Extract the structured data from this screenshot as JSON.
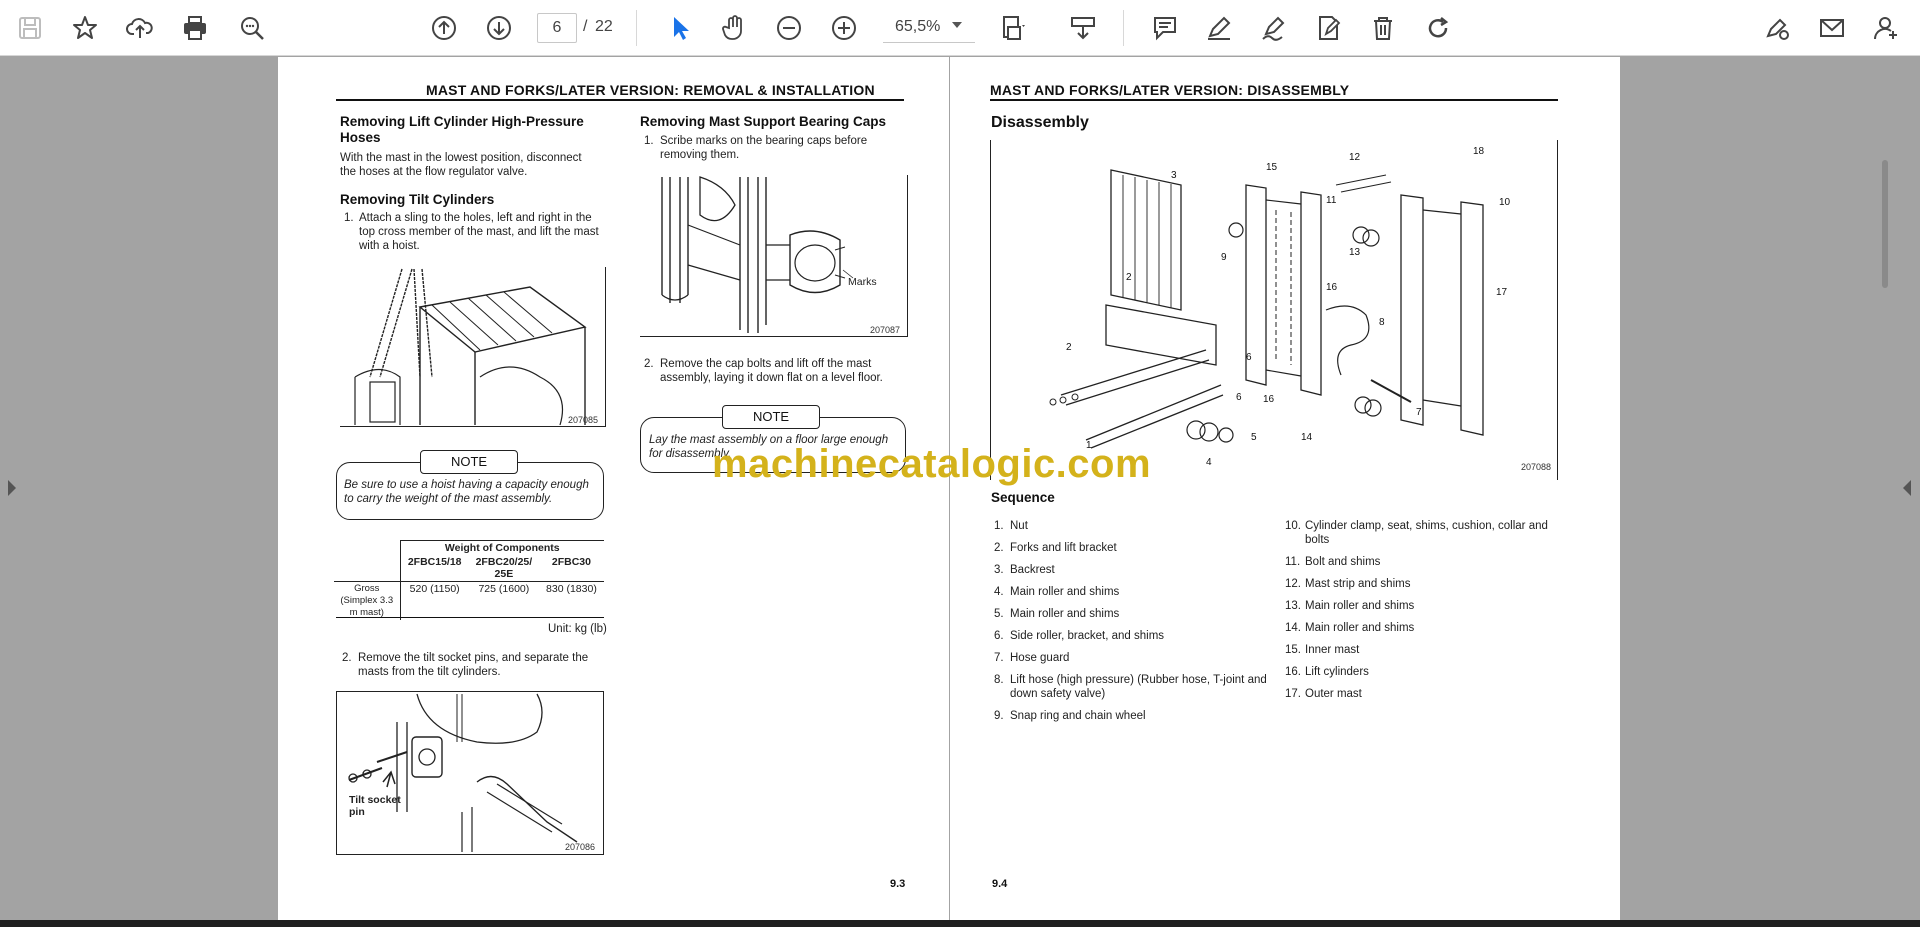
{
  "toolbar": {
    "page_current": "6",
    "page_separator": "/",
    "page_total": "22",
    "zoom": "65,5%"
  },
  "left_page": {
    "running_head": "MAST AND FORKS/LATER VERSION: REMOVAL & INSTALLATION",
    "h_hoses": "Removing Lift Cylinder High-Pressure Hoses",
    "p_hoses": "With the mast in the lowest position, disconnect the hoses at the flow regulator valve.",
    "h_tilt": "Removing Tilt Cylinders",
    "step1_num": "1.",
    "step1": "Attach a sling to the holes, left and right in the top cross member of the mast, and lift the mast with a hoist.",
    "fig1_code": "207085",
    "note_label": "NOTE",
    "note_text": "Be sure to use a hoist having a capacity enough to carry the weight of the mast assembly.",
    "table": {
      "title": "Weight of Components",
      "headers": [
        "2FBC15/18",
        "2FBC20/25/ 25E",
        "2FBC30"
      ],
      "row_label": "Gross (Simplex 3.3 m mast)",
      "row_values": [
        "520 (1150)",
        "725 (1600)",
        "830 (1830)"
      ],
      "unit": "Unit: kg (lb)"
    },
    "step2_num": "2.",
    "step2": "Remove the tilt socket pins, and separate the masts from the tilt cylinders.",
    "fig3_label": "Tilt socket pin",
    "fig3_code": "207086",
    "h_caps": "Removing Mast Support Bearing Caps",
    "caps_step1_num": "1.",
    "caps_step1": "Scribe marks on the bearing caps before removing them.",
    "fig2_label": "Marks",
    "fig2_code": "207087",
    "caps_step2_num": "2.",
    "caps_step2": "Remove the cap bolts and lift off the mast assembly, laying it down flat on a level floor.",
    "note2_label": "NOTE",
    "note2_text": "Lay the mast assembly on a floor large enough for disassembly.",
    "page_number": "9.3"
  },
  "right_page": {
    "running_head": "MAST AND FORKS/LATER VERSION: DISASSEMBLY",
    "h_disassembly": "Disassembly",
    "fig_code": "207088",
    "h_sequence": "Sequence",
    "seq_left": [
      {
        "n": "1.",
        "t": "Nut"
      },
      {
        "n": "2.",
        "t": "Forks and lift bracket"
      },
      {
        "n": "3.",
        "t": "Backrest"
      },
      {
        "n": "4.",
        "t": "Main roller and shims"
      },
      {
        "n": "5.",
        "t": "Main roller and shims"
      },
      {
        "n": "6.",
        "t": "Side roller, bracket, and shims"
      },
      {
        "n": "7.",
        "t": "Hose guard"
      },
      {
        "n": "8.",
        "t": "Lift hose (high pressure) (Rubber hose, T-joint and down safety valve)"
      },
      {
        "n": "9.",
        "t": "Snap ring and chain wheel"
      }
    ],
    "seq_right": [
      {
        "n": "10.",
        "t": "Cylinder clamp, seat, shims, cushion, collar and bolts"
      },
      {
        "n": "11.",
        "t": "Bolt and shims"
      },
      {
        "n": "12.",
        "t": "Mast strip and shims"
      },
      {
        "n": "13.",
        "t": "Main roller and shims"
      },
      {
        "n": "14.",
        "t": "Main roller and shims"
      },
      {
        "n": "15.",
        "t": "Inner mast"
      },
      {
        "n": "16.",
        "t": "Lift cylinders"
      },
      {
        "n": "17.",
        "t": "Outer mast"
      }
    ],
    "callouts": [
      "1",
      "2",
      "2",
      "3",
      "4",
      "5",
      "6",
      "6",
      "7",
      "8",
      "9",
      "10",
      "11",
      "12",
      "13",
      "14",
      "15",
      "16",
      "16",
      "17",
      "18"
    ],
    "page_number": "9.4"
  },
  "watermark": "machinecatalogic.com"
}
